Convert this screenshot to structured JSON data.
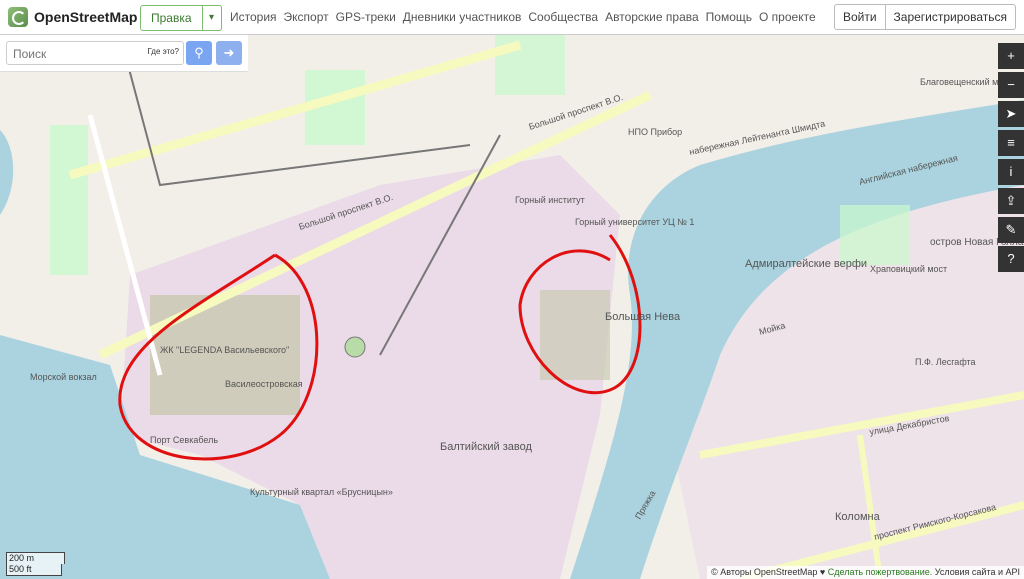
{
  "app": {
    "name": "OpenStreetMap"
  },
  "header": {
    "edit_label": "Правка",
    "nav": [
      "История",
      "Экспорт",
      "GPS-треки",
      "Дневники участников",
      "Сообщества",
      "Авторские права",
      "Помощь",
      "О проекте"
    ],
    "login_label": "Войти",
    "signup_label": "Зарегистрироваться"
  },
  "search": {
    "placeholder": "Поиск",
    "where_label": "Где это?"
  },
  "map_controls": [
    "zoom-in",
    "zoom-out",
    "locate",
    "layers",
    "info",
    "share",
    "note",
    "query"
  ],
  "map_labels": {
    "bolshoi_prospekt": "Большой проспект В.О.",
    "bolshoi_prospekt_2": "Большой проспект В.О.",
    "gorny": "Горный институт",
    "legenda": "ЖК \"LEGENDA Васильевского\"",
    "vasilyevskoye": "Василеостровская",
    "baltiysky": "Балтийский завод",
    "bolshaya_neva": "Большая Нева",
    "admiralty": "Адмиралтейские верфи",
    "novaya_gollandiya": "остров Новая Голландия",
    "blagoveshchensky": "Благовещенский мост",
    "angliyskaya": "Английская набережная",
    "kolomna": "Коломна",
    "port": "Порт Севкабель",
    "kvartal": "Культурный квартал «Брусницын»",
    "dekabristov": "улица Декабристов",
    "rimsky": "проспект Римского-Корсакова",
    "shmidta": "набережная Лейтенанта Шмидта",
    "npo": "НПО Прибор",
    "gornyi_uni": "Горный университет УЦ № 1",
    "khrapovitsky": "Храповицкий мост",
    "lesgaft": "П.Ф. Лесгафта",
    "pryazhka": "Пряжка",
    "moyka": "Мойка",
    "morvokzal": "Морской вокзал"
  },
  "scale": {
    "metric": "200 m",
    "imperial": "500 ft"
  },
  "attribution": {
    "prefix": "© Авторы OpenStreetMap ♥",
    "donate": "Сделать пожертвование.",
    "terms": "Условия сайта и API"
  },
  "colors": {
    "water": "#aad3df",
    "land": "#f2efe9",
    "industrial": "#ebdbe8",
    "park": "#c8facc",
    "annotation": "#e01010"
  }
}
